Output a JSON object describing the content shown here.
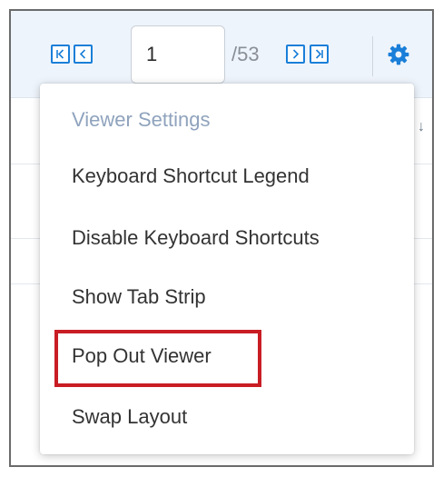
{
  "toolbar": {
    "page_input_value": "1",
    "page_total": "/53",
    "buttons": {
      "first_icon": "first-page-icon",
      "prev_icon": "previous-page-icon",
      "next_icon": "next-page-icon",
      "last_icon": "last-page-icon",
      "settings_icon": "gear-icon"
    }
  },
  "menu": {
    "heading": "Viewer Settings",
    "items": [
      {
        "label": "Keyboard Shortcut Legend"
      },
      {
        "label": "Disable Keyboard Shortcuts"
      },
      {
        "label": "Show Tab Strip"
      },
      {
        "label": "Pop Out Viewer",
        "highlighted": true
      },
      {
        "label": "Swap Layout"
      }
    ]
  },
  "colors": {
    "accent": "#1a7fd9",
    "highlight": "#c91d24",
    "heading_text": "#8fa3bd",
    "toolbar_bg": "#eef4fb"
  }
}
